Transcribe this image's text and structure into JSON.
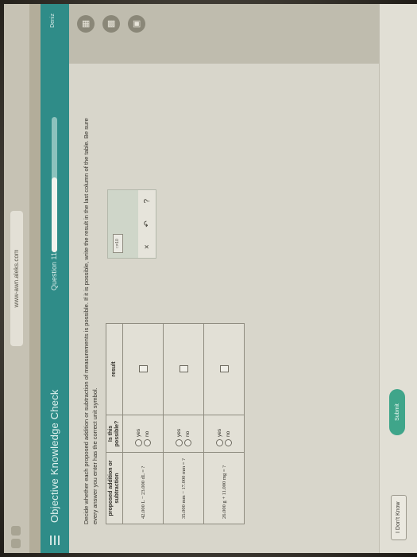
{
  "browser": {
    "address": "www-awn.aleks.com",
    "tab_title": ""
  },
  "header": {
    "section_title": "Objective Knowledge Check",
    "question_label": "Question 11",
    "progress": 0.55,
    "user_label": "Deniz"
  },
  "prompt": "Decide whether each proposed addition or subtraction of measurements is possible. If it is possible, write the result in the last column of the table. Be sure every answer you enter has the correct unit symbol.",
  "table": {
    "headers": [
      "proposed addition or subtraction",
      "Is this possible?",
      "result"
    ],
    "rows": [
      {
        "expr": "42.000 L − 23.000 dL = ?",
        "yes": "yes",
        "no": "no"
      },
      {
        "expr": "35.000 mm − 17.000 mm = ?",
        "yes": "yes",
        "no": "no"
      },
      {
        "expr": "26.000 g + 11.000 mg = ?",
        "yes": "yes",
        "no": "no"
      }
    ]
  },
  "tools": {
    "sci_label": "□×10",
    "clear": "×",
    "undo": "↶",
    "help": "?"
  },
  "footer": {
    "dont_know": "I Don't Know",
    "submit": "Submit"
  },
  "icons": [
    "menu-icon",
    "calculator-icon",
    "chart-icon",
    "periodic-table-icon"
  ],
  "colors": {
    "header": "#2f8c88",
    "submit": "#3fa58a"
  }
}
